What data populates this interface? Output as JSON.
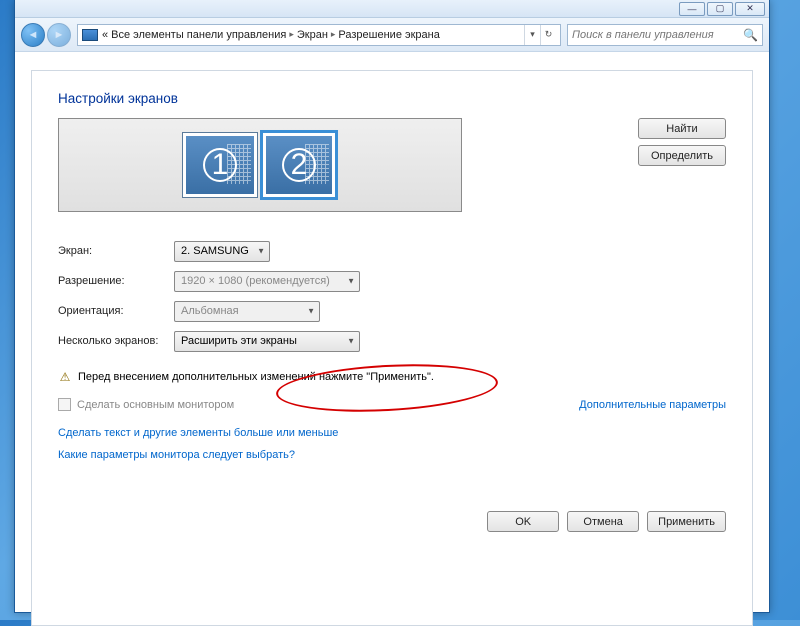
{
  "window": {
    "minimize": "—",
    "maximize": "▢",
    "close": "✕"
  },
  "nav": {
    "back": "◄",
    "fwd": "►",
    "crumb_prefix": "«",
    "crumb1": "Все элементы панели управления",
    "crumb2": "Экран",
    "crumb3": "Разрешение экрана",
    "search_placeholder": "Поиск в панели управления"
  },
  "heading": "Настройки экранов",
  "preview": {
    "mon1": "1",
    "mon2": "2",
    "find": "Найти",
    "detect": "Определить"
  },
  "form": {
    "screen_label": "Экран:",
    "screen_value": "2. SAMSUNG",
    "resolution_label": "Разрешение:",
    "resolution_value": "1920 × 1080 (рекомендуется)",
    "orientation_label": "Ориентация:",
    "orientation_value": "Альбомная",
    "multiple_label": "Несколько экранов:",
    "multiple_value": "Расширить эти экраны"
  },
  "warning": "Перед внесением дополнительных изменений нажмите \"Применить\".",
  "primary_cb": "Сделать основным монитором",
  "adv_params": "Дополнительные параметры",
  "link1": "Сделать текст и другие элементы больше или меньше",
  "link2": "Какие параметры монитора следует выбрать?",
  "buttons": {
    "ok": "OK",
    "cancel": "Отмена",
    "apply": "Применить"
  }
}
